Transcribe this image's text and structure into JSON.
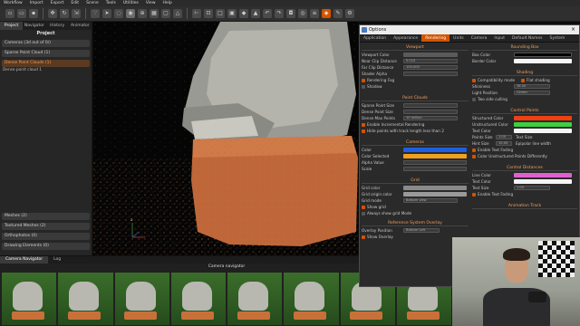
{
  "menubar": {
    "items": [
      "Workflow",
      "Import",
      "Export",
      "Edit",
      "Scene",
      "Tools",
      "Utilities",
      "View",
      "Help"
    ]
  },
  "left_panel": {
    "tabs": [
      "Project",
      "Navigator",
      "History",
      "Animator"
    ],
    "title": "Project",
    "sections": [
      "Cameras (3d out of 0/)",
      "Sparse Point Cloud (1)",
      "Dense Point Clouds (1)"
    ],
    "dense_item": "Dense point cloud 1",
    "bottom_sections": [
      "Meshes (2)",
      "Textured Meshes (2)",
      "Orthophotos (0)",
      "Drawing Elements (0)"
    ]
  },
  "bottom_panel": {
    "tabs": [
      "Camera Navigator",
      "Log"
    ],
    "title": "Camera navigator"
  },
  "dialog": {
    "title": "Options",
    "tabs": [
      "Application",
      "Appearance",
      "Rendering",
      "Units",
      "Camera",
      "Input",
      "Default Names",
      "System"
    ],
    "left": {
      "viewport": {
        "header": "Viewport",
        "rows": [
          {
            "label": "Viewport Color",
            "value": ""
          },
          {
            "label": "Near Clip Distance",
            "value": "0.010"
          },
          {
            "label": "Far Clip Distance",
            "value": "100.000"
          },
          {
            "label": "Shader Alpha",
            "value": ""
          }
        ],
        "checks": [
          "Rendering Fog",
          "Shadow"
        ]
      },
      "point_clouds": {
        "header": "Point Clouds",
        "rows": [
          {
            "label": "Sparse Point Size",
            "value": ""
          },
          {
            "label": "Dense Point Size",
            "value": ""
          },
          {
            "label": "Dense Max Points",
            "value": "10 million"
          }
        ],
        "checks": [
          "Enable Incremental Rendering",
          "Hide points with track length less than 2"
        ]
      },
      "cameras": {
        "header": "Cameras",
        "rows": [
          {
            "label": "Color",
            "color": "#1f5fe0"
          },
          {
            "label": "Color Selected",
            "color": "#f0a020"
          },
          {
            "label": "Alpha Value",
            "value": ""
          },
          {
            "label": "Scale",
            "value": ""
          }
        ]
      },
      "grid": {
        "header": "Grid",
        "rows": [
          {
            "label": "Grid color",
            "color": "#8a8a8a"
          },
          {
            "label": "Grid origin color",
            "color": "#9a9a9a"
          },
          {
            "label": "Grid mode",
            "value": "Bottom view"
          }
        ],
        "checks": [
          "Show grid",
          "Always show grid Mode"
        ]
      },
      "reference": {
        "header": "Reference System Overlay",
        "rows": [
          {
            "label": "Overlay Position",
            "value": "Bottom Left"
          }
        ],
        "checks": [
          "Show Overlay"
        ]
      }
    },
    "right": {
      "shading_bg": {
        "header": "Rounding Box",
        "rows": [
          {
            "label": "Box Color",
            "color": "#000000"
          },
          {
            "label": "Border Color",
            "color": "#f5f5f5"
          }
        ]
      },
      "shading": {
        "header": "Shading",
        "checks": [
          "Compatibility mode",
          "Flat shading"
        ],
        "rows": [
          {
            "label": "Shininess",
            "value": "16.00"
          },
          {
            "label": "Light Position",
            "value": "Center"
          }
        ],
        "extra": "Two side culling"
      },
      "control_points": {
        "header": "Control Points",
        "rows": [
          {
            "label": "Structured Color",
            "color": "#f04010"
          },
          {
            "label": "Unstructured Color",
            "color": "#3cd040"
          },
          {
            "label": "Text Color",
            "color": "#f5f5f5"
          },
          {
            "label": "Points Size",
            "value": "1.00"
          },
          {
            "label": "Hint Size",
            "value": "10.00"
          }
        ],
        "side_labels": [
          "Text Size",
          "Epipolar line width"
        ],
        "checks": [
          "Enable Text Fading",
          "Color Unstructured Points Differently"
        ]
      },
      "control_distances": {
        "header": "Control Distances",
        "rows": [
          {
            "label": "Line Color",
            "color": "#e060d0"
          },
          {
            "label": "Text Color",
            "color": "#f5f5f5"
          },
          {
            "label": "Text Size",
            "value": "1.00"
          }
        ],
        "checks": [
          "Enable Text Fading"
        ]
      },
      "animation": {
        "header": "Animation Track"
      }
    }
  },
  "colors": {
    "accent": "#d35400",
    "point_orange": "#c8703a"
  }
}
